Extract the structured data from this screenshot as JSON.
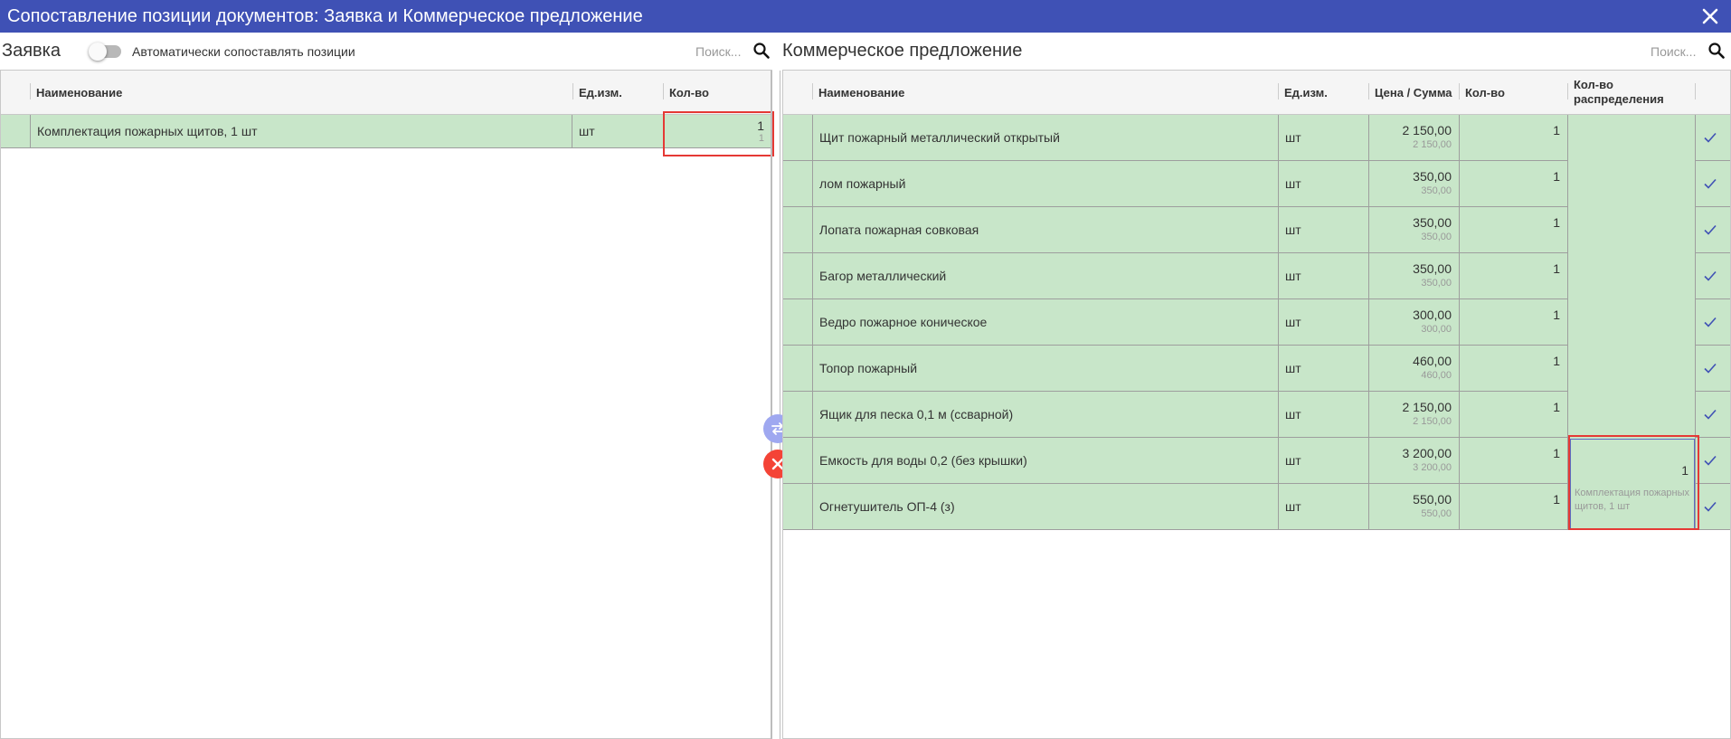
{
  "window": {
    "title": "Сопоставление позиции документов: Заявка и Коммерческое предложение"
  },
  "left": {
    "title": "Заявка",
    "toggle_label": "Автоматически сопоставлять позиции",
    "search_placeholder": "Поиск...",
    "columns": {
      "name": "Наименование",
      "unit": "Ед.изм.",
      "qty": "Кол-во"
    },
    "rows": [
      {
        "name": "Комплектация пожарных щитов, 1 шт",
        "unit": "шт",
        "qty": "1",
        "qty_sub": "1"
      }
    ]
  },
  "right": {
    "title": "Коммерческое предложение",
    "search_placeholder": "Поиск...",
    "columns": {
      "name": "Наименование",
      "unit": "Ед.изм.",
      "price": "Цена / Сумма",
      "qty": "Кол-во",
      "alloc": "Кол-во распределения"
    },
    "rows": [
      {
        "name": "Щит пожарный металлический открытый",
        "unit": "шт",
        "price": "2 150,00",
        "sum": "2 150,00",
        "qty": "1"
      },
      {
        "name": "лом пожарный",
        "unit": "шт",
        "price": "350,00",
        "sum": "350,00",
        "qty": "1"
      },
      {
        "name": "Лопата пожарная совковая",
        "unit": "шт",
        "price": "350,00",
        "sum": "350,00",
        "qty": "1"
      },
      {
        "name": "Багор металлический",
        "unit": "шт",
        "price": "350,00",
        "sum": "350,00",
        "qty": "1"
      },
      {
        "name": "Ведро пожарное коническое",
        "unit": "шт",
        "price": "300,00",
        "sum": "300,00",
        "qty": "1"
      },
      {
        "name": "Топор пожарный",
        "unit": "шт",
        "price": "460,00",
        "sum": "460,00",
        "qty": "1"
      },
      {
        "name": "Ящик для песка 0,1 м (ссварной)",
        "unit": "шт",
        "price": "2 150,00",
        "sum": "2 150,00",
        "qty": "1"
      },
      {
        "name": "Емкость для воды 0,2 (без крышки)",
        "unit": "шт",
        "price": "3 200,00",
        "sum": "3 200,00",
        "qty": "1"
      },
      {
        "name": "Огнетушитель ОП-4 (з)",
        "unit": "шт",
        "price": "550,00",
        "sum": "550,00",
        "qty": "1"
      }
    ],
    "allocation": {
      "qty": "1",
      "label": "Комплектация пожарных щитов, 1 шт"
    }
  },
  "colors": {
    "titlebar": "#3f51b5",
    "row_matched": "#c8e6c9",
    "highlight": "#e53935",
    "check": "#3f51b5",
    "delete": "#f44336"
  }
}
